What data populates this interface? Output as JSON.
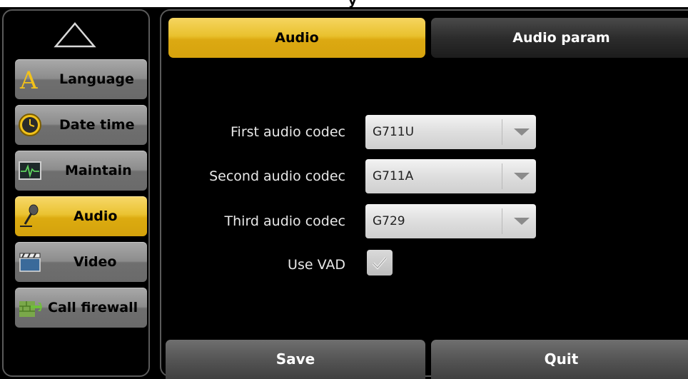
{
  "header_fragment": "y",
  "nav": {
    "up_icon": "up-triangle-icon",
    "items": [
      {
        "label": "Language",
        "icon": "letter-a-icon",
        "active": false
      },
      {
        "label": "Date time",
        "icon": "clock-icon",
        "active": false
      },
      {
        "label": "Maintain",
        "icon": "monitor-pulse-icon",
        "active": false
      },
      {
        "label": "Audio",
        "icon": "microphone-icon",
        "active": true
      },
      {
        "label": "Video",
        "icon": "clapperboard-icon",
        "active": false
      },
      {
        "label": "Call firewall",
        "icon": "firewall-icon",
        "active": false
      }
    ]
  },
  "tabs": [
    {
      "label": "Audio",
      "active": true
    },
    {
      "label": "Audio param",
      "active": false
    }
  ],
  "form": {
    "first_codec": {
      "label": "First audio codec",
      "value": "G711U"
    },
    "second_codec": {
      "label": "Second audio codec",
      "value": "G711A"
    },
    "third_codec": {
      "label": "Third audio codec",
      "value": "G729"
    },
    "use_vad": {
      "label": "Use VAD",
      "checked": true
    }
  },
  "actions": {
    "save_label": "Save",
    "quit_label": "Quit"
  },
  "colors": {
    "accent": "#e9c12e",
    "background": "#000000",
    "inactive_button": "#8c8c8c"
  }
}
